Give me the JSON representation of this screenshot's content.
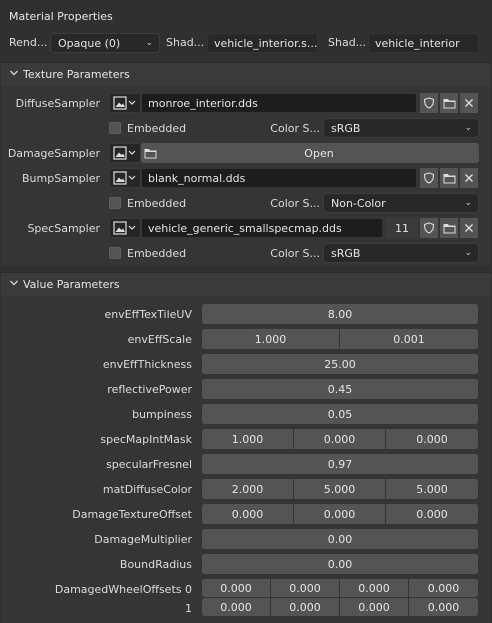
{
  "header": {
    "title": "Material Properties",
    "render_label": "Rend...",
    "render_value": "Opaque (0)",
    "shader_label_1": "Shad...",
    "shader_value_1": "vehicle_interior.s...",
    "shader_label_2": "Shad...",
    "shader_value_2": "vehicle_interior"
  },
  "texture_panel": {
    "title": "Texture Parameters",
    "embedded_label": "Embedded",
    "color_space_label": "Color S...",
    "open_label": "Open",
    "samplers": [
      {
        "name": "DiffuseSampler",
        "file": "monroe_interior.dds",
        "color_space": "sRGB"
      },
      {
        "name": "DamageSampler"
      },
      {
        "name": "BumpSampler",
        "file": "blank_normal.dds",
        "color_space": "Non-Color"
      },
      {
        "name": "SpecSampler",
        "file": "vehicle_generic_smallspecmap.dds",
        "users": "11",
        "color_space": "sRGB"
      }
    ]
  },
  "value_panel": {
    "title": "Value Parameters",
    "params": [
      {
        "name": "envEffTexTileUV",
        "values": [
          "8.00"
        ]
      },
      {
        "name": "envEffScale",
        "values": [
          "1.000",
          "0.001"
        ]
      },
      {
        "name": "envEffThickness",
        "values": [
          "25.00"
        ]
      },
      {
        "name": "reflectivePower",
        "values": [
          "0.45"
        ]
      },
      {
        "name": "bumpiness",
        "values": [
          "0.05"
        ]
      },
      {
        "name": "specMapIntMask",
        "values": [
          "1.000",
          "0.000",
          "0.000"
        ]
      },
      {
        "name": "specularFresnel",
        "values": [
          "0.97"
        ]
      },
      {
        "name": "matDiffuseColor",
        "values": [
          "2.000",
          "5.000",
          "5.000"
        ]
      },
      {
        "name": "DamageTextureOffset",
        "values": [
          "0.000",
          "0.000",
          "0.000"
        ]
      },
      {
        "name": "DamageMultiplier",
        "values": [
          "0.00"
        ]
      },
      {
        "name": "BoundRadius",
        "values": [
          "0.00"
        ]
      }
    ],
    "wheel": {
      "name": "DamagedWheelOffsets 0",
      "row1_label": "1",
      "row0": [
        "0.000",
        "0.000",
        "0.000",
        "0.000"
      ],
      "row1": [
        "0.000",
        "0.000",
        "0.000",
        "0.000"
      ]
    }
  },
  "colors": {
    "bg": "#303030",
    "panel": "#353535",
    "field": "#545454",
    "input": "#1d1d1d"
  },
  "icons": [
    "chevron-down-icon",
    "image-icon",
    "shield-icon",
    "folder-icon",
    "close-icon"
  ]
}
